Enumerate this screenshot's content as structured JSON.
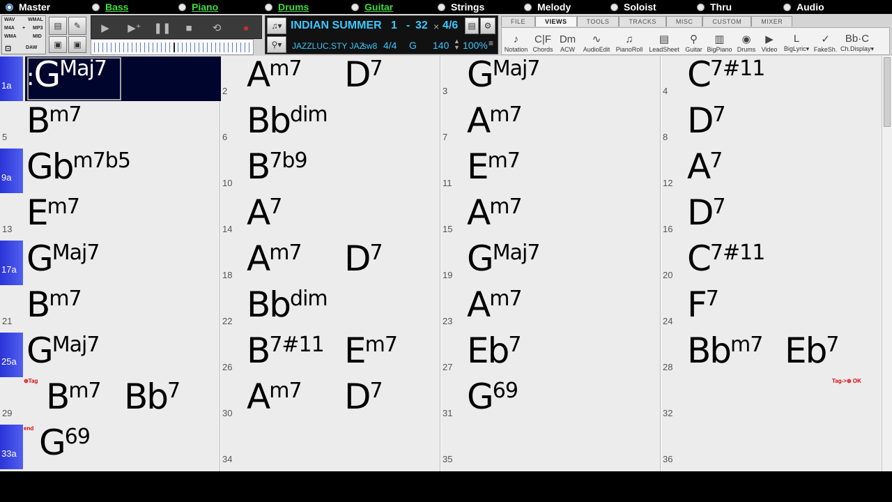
{
  "tracks": [
    {
      "name": "Master",
      "selected": true,
      "green": false
    },
    {
      "name": "Bass",
      "selected": false,
      "green": true
    },
    {
      "name": "Piano",
      "selected": false,
      "green": true
    },
    {
      "name": "Drums",
      "selected": false,
      "green": true
    },
    {
      "name": "Guitar",
      "selected": false,
      "green": true
    },
    {
      "name": "Strings",
      "selected": false,
      "green": false
    },
    {
      "name": "Melody",
      "selected": false,
      "green": false
    },
    {
      "name": "Soloist",
      "selected": false,
      "green": false
    },
    {
      "name": "Thru",
      "selected": false,
      "green": false
    },
    {
      "name": "Audio",
      "selected": false,
      "green": false
    }
  ],
  "toolbar": {
    "formats": {
      "wav": "WAV",
      "wma_l": "WMAL",
      "m4a": "M4A",
      "mp3": "MP3",
      "wma": "WMA",
      "mid": "MID",
      "daw": "DAW",
      "plus": "+"
    },
    "song_title": "INDIAN SUMMER",
    "range_start": "1",
    "range_dash": "-",
    "range_end": "32",
    "times": "×",
    "choruses": "4/6",
    "style": "JAZZLUC.STY JAZ",
    "feel": "sw8",
    "time_sig": "4/4",
    "key": "G",
    "tempo": "140",
    "tempo_pct": "100%"
  },
  "tabs": [
    {
      "label": "FILE",
      "active": false
    },
    {
      "label": "VIEWS",
      "active": true
    },
    {
      "label": "TOOLS",
      "active": false
    },
    {
      "label": "TRACKS",
      "active": false
    },
    {
      "label": "MISC",
      "active": false
    },
    {
      "label": "CUSTOM",
      "active": false
    },
    {
      "label": "MIXER",
      "active": false
    }
  ],
  "views": [
    {
      "label": "Notation",
      "icon": "♪"
    },
    {
      "label": "Chords",
      "icon": "C|F"
    },
    {
      "label": "ACW",
      "icon": "Dm"
    },
    {
      "label": "AudioEdit",
      "icon": "∿"
    },
    {
      "label": "PianoRoll",
      "icon": "♫"
    },
    {
      "label": "LeadSheet",
      "icon": "▤"
    },
    {
      "label": "Guitar",
      "icon": "⚲"
    },
    {
      "label": "BigPiano",
      "icon": "▥"
    },
    {
      "label": "Drums",
      "icon": "◉"
    },
    {
      "label": "Video",
      "icon": "▶"
    },
    {
      "label": "BigLyric▾",
      "icon": "L"
    },
    {
      "label": "FakeSh.",
      "icon": "✓"
    },
    {
      "label": "Ch.Display▾",
      "icon": "Bb·C"
    }
  ],
  "bars": [
    {
      "num": "1a",
      "marker": true,
      "selected": true,
      "chords": [
        {
          "root": "G",
          "ext": "Maj7",
          "prefix": ":"
        }
      ]
    },
    {
      "num": "2",
      "chords": [
        {
          "root": "A",
          "ext": "m7"
        },
        {
          "root": "D",
          "ext": "7"
        }
      ]
    },
    {
      "num": "3",
      "chords": [
        {
          "root": "G",
          "ext": "Maj7"
        }
      ]
    },
    {
      "num": "4",
      "chords": [
        {
          "root": "C",
          "ext": "7#11"
        }
      ]
    },
    {
      "num": "5",
      "chords": [
        {
          "root": "B",
          "ext": "m7"
        }
      ]
    },
    {
      "num": "6",
      "chords": [
        {
          "root": "Bb",
          "ext": "dim"
        }
      ]
    },
    {
      "num": "7",
      "chords": [
        {
          "root": "A",
          "ext": "m7"
        }
      ]
    },
    {
      "num": "8",
      "chords": [
        {
          "root": "D",
          "ext": "7"
        }
      ]
    },
    {
      "num": "9a",
      "marker": true,
      "chords": [
        {
          "root": "Gb",
          "ext": "m7b5"
        }
      ]
    },
    {
      "num": "10",
      "chords": [
        {
          "root": "B",
          "ext": "7b9"
        }
      ]
    },
    {
      "num": "11",
      "chords": [
        {
          "root": "E",
          "ext": "m7"
        }
      ]
    },
    {
      "num": "12",
      "chords": [
        {
          "root": "A",
          "ext": "7"
        }
      ]
    },
    {
      "num": "13",
      "chords": [
        {
          "root": "E",
          "ext": "m7"
        }
      ]
    },
    {
      "num": "14",
      "chords": [
        {
          "root": "A",
          "ext": "7"
        }
      ]
    },
    {
      "num": "15",
      "chords": [
        {
          "root": "A",
          "ext": "m7"
        }
      ]
    },
    {
      "num": "16",
      "chords": [
        {
          "root": "D",
          "ext": "7"
        }
      ]
    },
    {
      "num": "17a",
      "marker": true,
      "chords": [
        {
          "root": "G",
          "ext": "Maj7"
        }
      ]
    },
    {
      "num": "18",
      "chords": [
        {
          "root": "A",
          "ext": "m7"
        },
        {
          "root": "D",
          "ext": "7"
        }
      ]
    },
    {
      "num": "19",
      "chords": [
        {
          "root": "G",
          "ext": "Maj7"
        }
      ]
    },
    {
      "num": "20",
      "chords": [
        {
          "root": "C",
          "ext": "7#11"
        }
      ]
    },
    {
      "num": "21",
      "chords": [
        {
          "root": "B",
          "ext": "m7"
        }
      ]
    },
    {
      "num": "22",
      "chords": [
        {
          "root": "Bb",
          "ext": "dim"
        }
      ]
    },
    {
      "num": "23",
      "chords": [
        {
          "root": "A",
          "ext": "m7"
        }
      ]
    },
    {
      "num": "24",
      "chords": [
        {
          "root": "F",
          "ext": "7"
        }
      ]
    },
    {
      "num": "25a",
      "marker": true,
      "chords": [
        {
          "root": "G",
          "ext": "Maj7"
        }
      ]
    },
    {
      "num": "26",
      "chords": [
        {
          "root": "B",
          "ext": "7#11"
        },
        {
          "root": "E",
          "ext": "m7"
        }
      ]
    },
    {
      "num": "27",
      "chords": [
        {
          "root": "Eb",
          "ext": "7"
        }
      ]
    },
    {
      "num": "28",
      "chords": [
        {
          "root": "Bb",
          "ext": "m7"
        },
        {
          "root": "Eb",
          "ext": "7"
        }
      ]
    },
    {
      "num": "29",
      "chords": [
        {
          "root": "B",
          "ext": "m7"
        },
        {
          "root": "Bb",
          "ext": "7"
        }
      ],
      "tag": "⊕Tag"
    },
    {
      "num": "30",
      "chords": [
        {
          "root": "A",
          "ext": "m7"
        },
        {
          "root": "D",
          "ext": "7"
        }
      ]
    },
    {
      "num": "31",
      "chords": [
        {
          "root": "G",
          "ext": "69"
        }
      ]
    },
    {
      "num": "32",
      "chords": [],
      "tag": "Tag->⊕ OK"
    },
    {
      "num": "33a",
      "marker": true,
      "chords": [
        {
          "root": "G",
          "ext": "69"
        }
      ],
      "tag": "end"
    },
    {
      "num": "34",
      "chords": []
    },
    {
      "num": "35",
      "chords": []
    },
    {
      "num": "36",
      "chords": []
    }
  ],
  "colors": {
    "marker": "#2b34d8",
    "lcd": "#39c8ff",
    "active_track": "#3cdc3c",
    "selection": "#00052e"
  }
}
